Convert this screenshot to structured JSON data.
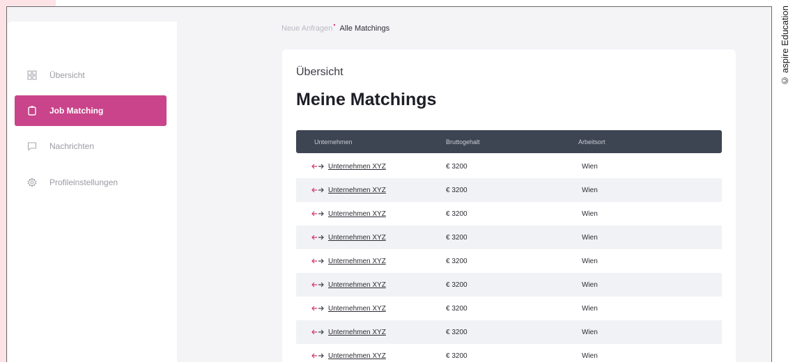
{
  "sidebar": {
    "items": [
      {
        "label": "Übersicht",
        "icon": "grid-icon",
        "active": false
      },
      {
        "label": "Job Matching",
        "icon": "clipboard-icon",
        "active": true
      },
      {
        "label": "Nachrichten",
        "icon": "chat-icon",
        "active": false
      },
      {
        "label": "Profileinstellungen",
        "icon": "gear-icon",
        "active": false
      }
    ]
  },
  "breadcrumb": {
    "inactive": "Neue Anfragen",
    "dot": "•",
    "active": "Alle Matchings"
  },
  "main": {
    "subtitle": "Übersicht",
    "title": "Meine Matchings",
    "table": {
      "headers": [
        "Unternehmen",
        "Bruttogehalt",
        "Arbeitsort"
      ],
      "rows": [
        {
          "company": "Unternehmen XYZ",
          "salary": "€ 3200",
          "location": "Wien"
        },
        {
          "company": "Unternehmen XYZ",
          "salary": "€ 3200",
          "location": "Wien"
        },
        {
          "company": "Unternehmen XYZ",
          "salary": "€ 3200",
          "location": "Wien"
        },
        {
          "company": "Unternehmen XYZ",
          "salary": "€ 3200",
          "location": "Wien"
        },
        {
          "company": "Unternehmen XYZ",
          "salary": "€ 3200",
          "location": "Wien"
        },
        {
          "company": "Unternehmen XYZ",
          "salary": "€ 3200",
          "location": "Wien"
        },
        {
          "company": "Unternehmen XYZ",
          "salary": "€ 3200",
          "location": "Wien"
        },
        {
          "company": "Unternehmen XYZ",
          "salary": "€ 3200",
          "location": "Wien"
        },
        {
          "company": "Unternehmen XYZ",
          "salary": "€ 3200",
          "location": "Wien"
        }
      ]
    }
  },
  "copyright": "© aspire Education",
  "colors": {
    "accent": "#c9448a",
    "table_header": "#3d4552",
    "breadcrumb_dot": "#d6336c",
    "pink_strip": "#fbe3e6"
  }
}
